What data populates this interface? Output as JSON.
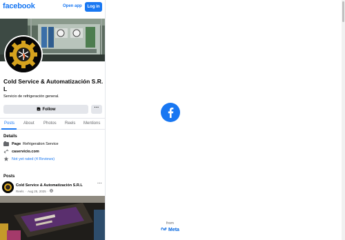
{
  "header": {
    "logo": "facebook",
    "open_app_label": "Open app",
    "login_label": "Log in"
  },
  "profile": {
    "name": "Cold Service & Automatización S.R. L",
    "description": "Servicio de refrigeración general.",
    "follow_label": "Follow",
    "more_label": "···"
  },
  "tabs": [
    {
      "label": "Posts",
      "active": true
    },
    {
      "label": "About",
      "active": false
    },
    {
      "label": "Photos",
      "active": false
    },
    {
      "label": "Reels",
      "active": false
    },
    {
      "label": "Mentions",
      "active": false
    }
  ],
  "details": {
    "title": "Details",
    "category_key": "Page",
    "category_value": "Refrigeration Service",
    "website": "caservicio.com",
    "rating": "Not yet rated (4 Reviews)"
  },
  "posts": {
    "title": "Posts",
    "items": [
      {
        "author": "Cold Service & Automatización S.R.L",
        "type": "Reels",
        "date": "Aug 25, 2025",
        "more_label": "···"
      }
    ]
  },
  "footer": {
    "from_label": "from",
    "meta_label": "Meta"
  },
  "colors": {
    "brand": "#1877f2",
    "meta": "#0064e0",
    "secondary_text": "#65676b",
    "button_gray": "#e4e6eb"
  },
  "icons": {
    "facebook_badge": "facebook-f-icon",
    "follow": "follow-icon",
    "category": "flag-icon",
    "website": "link-icon",
    "rating": "star-icon",
    "privacy": "globe-icon"
  }
}
